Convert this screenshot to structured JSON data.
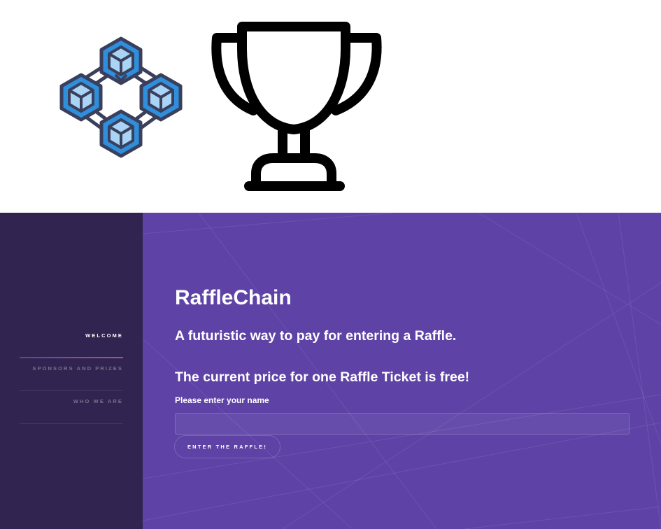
{
  "brand": {
    "title": "RaffleChain",
    "tagline": "A futuristic way to pay for entering a Raffle.",
    "price_text": "The current price for one Raffle Ticket is free!"
  },
  "images": {
    "blockchain": "blockchain-network-icon",
    "trophy": "trophy-icon"
  },
  "sidebar": {
    "items": [
      {
        "label": "WELCOME",
        "active": true
      },
      {
        "label": "SPONSORS AND PRIZES",
        "active": false
      },
      {
        "label": "WHO WE ARE",
        "active": false
      }
    ]
  },
  "form": {
    "name_label": "Please enter your name",
    "name_value": "",
    "name_placeholder": "",
    "submit_label": "ENTER THE RAFFLE!"
  },
  "colors": {
    "sidebar_bg": "#312450",
    "main_bg": "#5e42a6",
    "accent_gradient_start": "#5e42a6",
    "accent_gradient_end": "#b74e91",
    "cube_blue": "#2f8fdc",
    "cube_light": "#a9d4f5",
    "cube_outline": "#3a3f5c"
  }
}
